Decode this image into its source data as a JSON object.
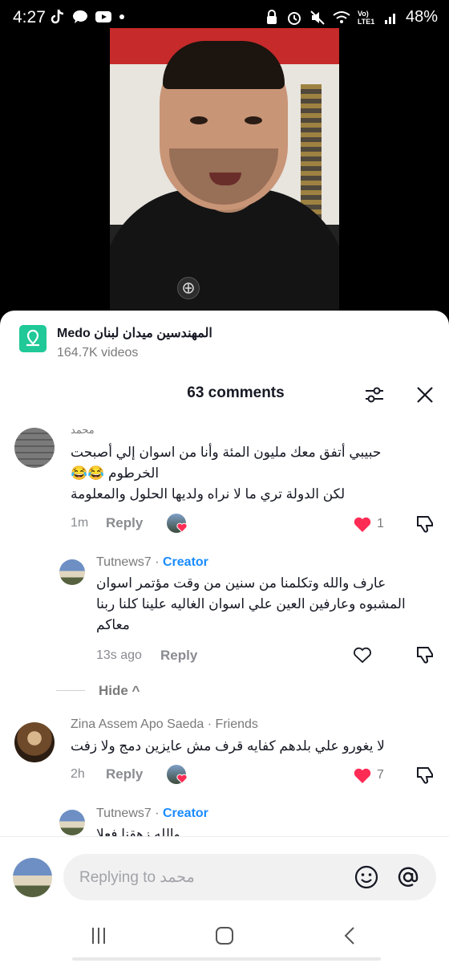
{
  "status_bar": {
    "time": "4:27",
    "signal_label": "Vo) LTE1",
    "battery": "48%"
  },
  "music": {
    "title": "المهندسين ميدان لبنان Medo",
    "subtitle": "164.7K videos"
  },
  "header": {
    "title": "63 comments"
  },
  "comments": [
    {
      "user": "محمد",
      "text_line1": "حبيبي أتفق معك مليون المئة وأنا من اسوان إلي أصبحت",
      "text_line2": "الخرطوم 😂😂",
      "text_line3": "لكن الدولة تري ما لا نراه ولديها الحلول والمعلومة",
      "time": "1m",
      "reply_label": "Reply",
      "likes": "1"
    },
    {
      "user": "Tutnews7",
      "badge": "Creator",
      "text_line1": "عارف والله وتكلمنا من سنين من وقت مؤتمر اسوان",
      "text_line2": "المشبوه وعارفين العين علي اسوان الغاليه علينا كلنا ربنا",
      "text_line3": "معاكم",
      "time": "13s ago",
      "reply_label": "Reply"
    },
    {
      "user": "Zina Assem Apo Saeda",
      "badge": "Friends",
      "text_line1": "لا يغورو علي بلدهم كفايه قرف مش عايزين دمج ولا زفت",
      "time": "2h",
      "reply_label": "Reply",
      "likes": "7"
    },
    {
      "user": "Tutnews7",
      "badge": "Creator",
      "text_line1": "والله زهقنا فعلا"
    }
  ],
  "hide_label": "Hide ^",
  "separator": " · ",
  "input": {
    "placeholder": "Replying to محمد"
  },
  "colors": {
    "accent_like": "#fe2c55",
    "creator": "#1a8cff",
    "music_icon": "#20c997"
  }
}
